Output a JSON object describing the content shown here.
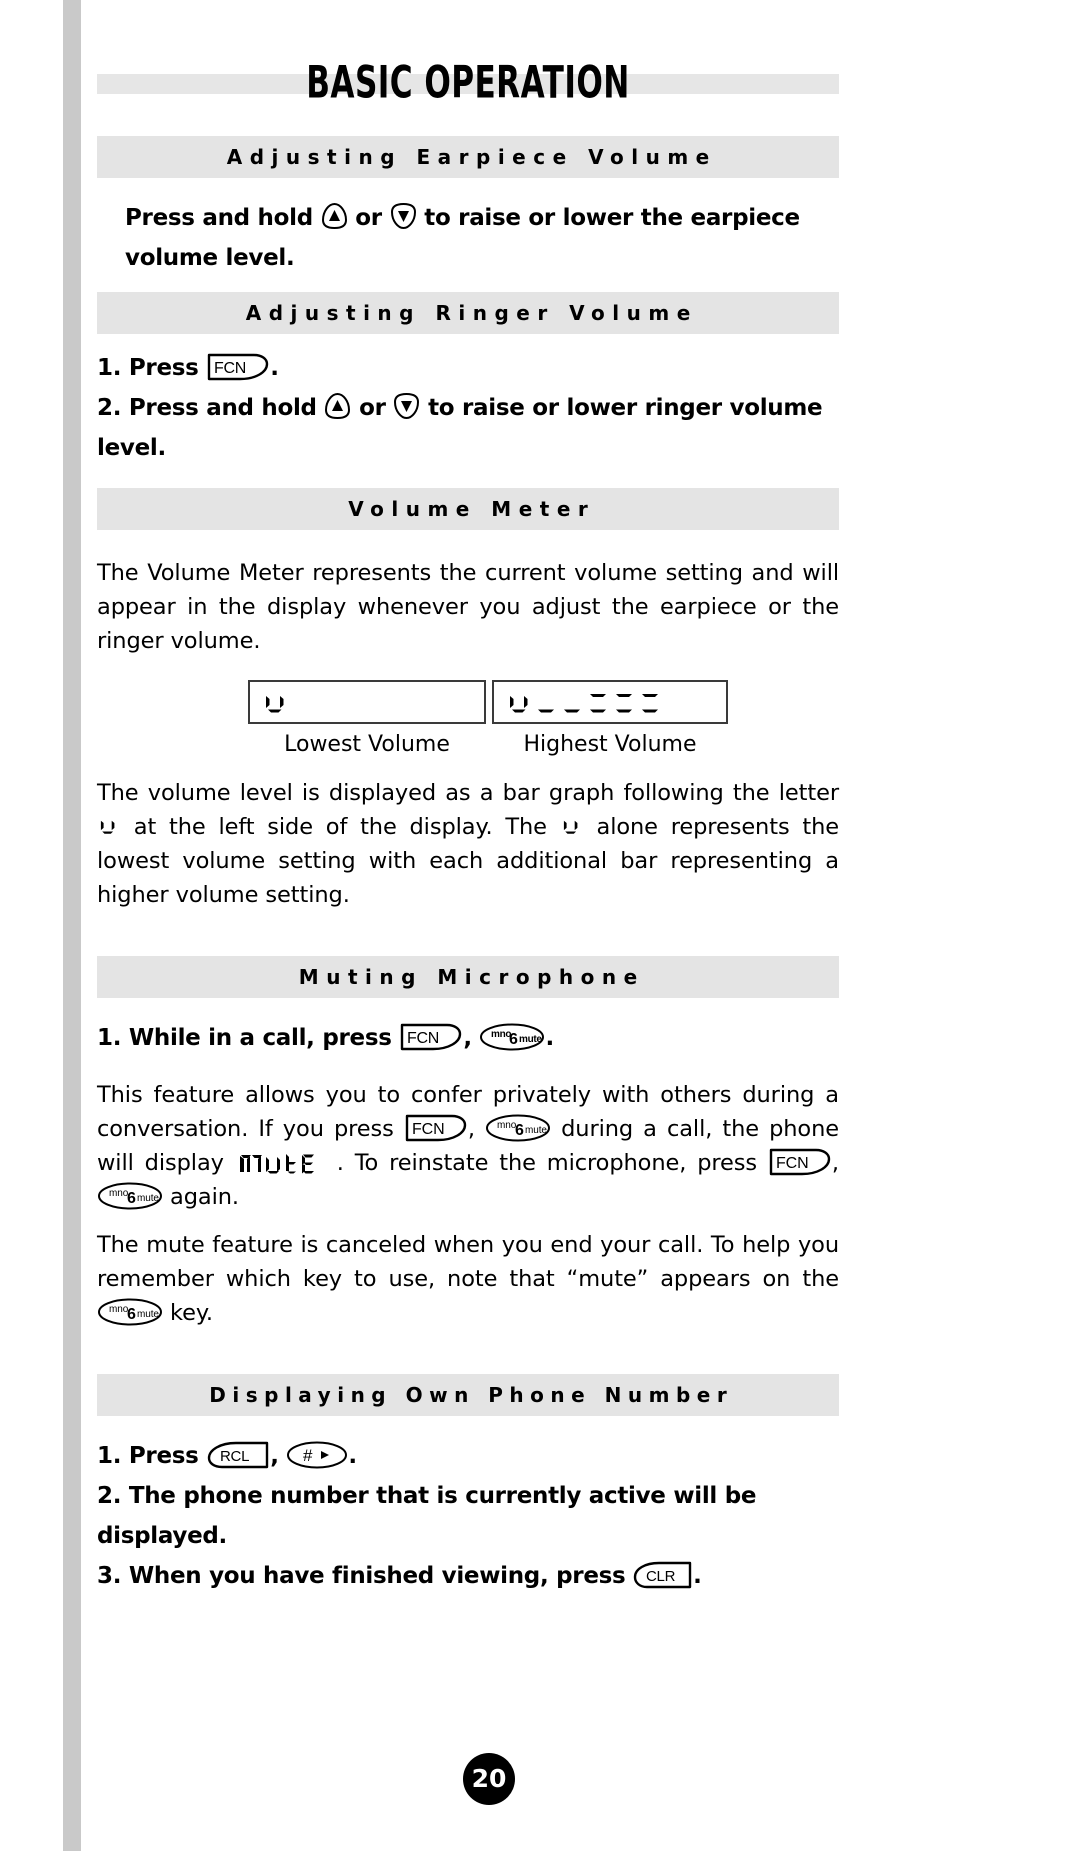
{
  "document": {
    "title": "BASIC OPERATION",
    "page_number": "20"
  },
  "sections": [
    {
      "id": "adjusting-earpiece-volume",
      "heading": "Adjusting Earpiece Volume",
      "body_bold_1": "Press and hold ",
      "body_bold_2": " or ",
      "body_bold_3": " to raise or lower the earpiece volume level."
    },
    {
      "id": "adjusting-ringer-volume",
      "heading": "Adjusting Ringer Volume",
      "step1_prefix": "1. Press ",
      "step1_suffix": ".",
      "step2_prefix": "2. Press and hold ",
      "step2_middle": " or ",
      "step2_suffix": " to raise or lower ringer volume level."
    },
    {
      "id": "volume-meter",
      "heading": "Volume Meter",
      "para1": "The Volume Meter represents the current volume setting and will appear in the display whenever you adjust the earpiece or the ringer volume.",
      "figure": {
        "lowest_caption": "Lowest Volume",
        "highest_caption": "Highest Volume",
        "lowest_bars": 0,
        "highest_bars": 5
      },
      "para2_a": "The volume level is displayed as a bar graph following the letter ",
      "para2_b": " at the left side of the display. The ",
      "para2_c": " alone represents the lowest volume setting with each additional bar representing a higher volume setting."
    },
    {
      "id": "muting-microphone",
      "heading": "Muting Microphone",
      "step1_a": "1. While in a call, press ",
      "step1_b": ", ",
      "step1_c": ".",
      "para1_a": "This feature allows you to confer privately with others during a conversation. If you press ",
      "para1_b": ", ",
      "para1_c": " during a call, the phone will display ",
      "para1_d": ". To reinstate the microphone, press ",
      "para1_e": ", ",
      "para1_f": " again.",
      "lcd_word": "MUTE",
      "para2_a": "The mute feature is canceled when you end your call. To help you remember which key to use, note that “mute” appears on the ",
      "para2_b": " key."
    },
    {
      "id": "displaying-own-phone-number",
      "heading": "Displaying Own Phone Number",
      "step1_a": "1. Press ",
      "step1_b": ", ",
      "step1_c": ".",
      "step2": "2. The phone number that is currently active will be displayed.",
      "step3_a": "3. When you have finished viewing, press ",
      "step3_b": "."
    }
  ],
  "keys": {
    "fcn": "FCN",
    "rcl": "RCL",
    "clr": "CLR",
    "hash": "#",
    "mute_top": "mno",
    "mute_digit": "6",
    "mute_label": "mute",
    "arrow_up": "▲",
    "arrow_down": "▼"
  },
  "colors": {
    "header_bar": "#e4e4e4",
    "title_bar": "#e6e6e6",
    "page_edge": "#c9c9c9",
    "text": "#000000",
    "lcd_border": "#3a3a3a"
  }
}
